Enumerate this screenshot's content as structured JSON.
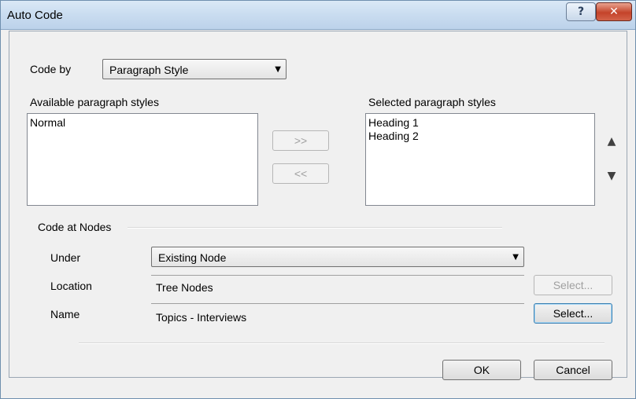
{
  "window": {
    "title": "Auto Code",
    "help_glyph": "?",
    "close_glyph": "✕"
  },
  "code_by": {
    "label": "Code by",
    "value": "Paragraph Style",
    "arrow_glyph": "▼"
  },
  "available": {
    "label": "Available paragraph styles",
    "items": [
      "Normal"
    ]
  },
  "selected": {
    "label": "Selected paragraph styles",
    "items": [
      "Heading 1",
      "Heading 2"
    ]
  },
  "transfer": {
    "add_label": ">>",
    "remove_label": "<<"
  },
  "order": {
    "up_glyph": "▲",
    "down_glyph": "▼"
  },
  "nodes": {
    "section_label": "Code at Nodes",
    "under_label": "Under",
    "under_value": "Existing Node",
    "under_arrow": "▼",
    "location_label": "Location",
    "location_value": "Tree Nodes",
    "location_select_label": "Select...",
    "name_label": "Name",
    "name_value": "Topics - Interviews",
    "name_select_label": "Select..."
  },
  "footer": {
    "ok_label": "OK",
    "cancel_label": "Cancel"
  }
}
